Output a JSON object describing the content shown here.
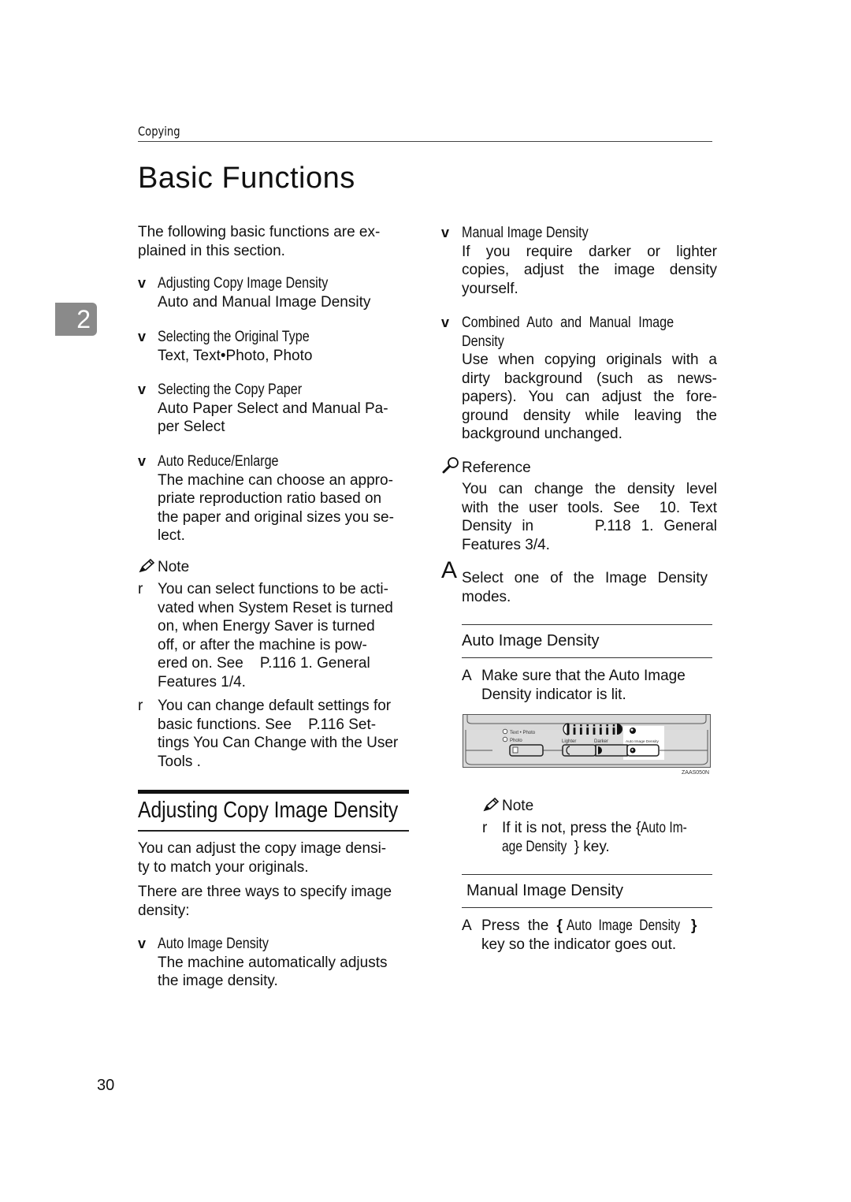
{
  "running_head": "Copying",
  "page_title": "Basic Functions",
  "chapter_tab": "2",
  "page_number": "30",
  "left_column": {
    "intro": "The following basic functions are explained in this section.",
    "intro_lines": [
      "The following basic functions are ex-",
      "plained in this section."
    ],
    "bullet_marker": "v",
    "functions": [
      {
        "title": "Adjusting Copy Image Density",
        "lines": [
          "Auto and Manual Image Density"
        ]
      },
      {
        "title": "Selecting the Original Type",
        "lines": [
          "Text, Text•Photo, Photo"
        ]
      },
      {
        "title": "Selecting the Copy Paper",
        "lines": [
          "Auto Paper Select and Manual Pa-",
          "per Select"
        ]
      },
      {
        "title": "Auto Reduce/Enlarge",
        "lines": [
          "The machine can choose an appro-",
          "priate reproduction ratio based on",
          "the paper and original sizes you se-",
          "lect."
        ]
      }
    ],
    "note": {
      "label": "Note",
      "marker": "r",
      "items": [
        {
          "lines": [
            "You can select functions to be acti-",
            "vated when System Reset is turned",
            "on, when Energy Saver is turned",
            "off, or after the machine is pow-",
            "ered on. See    P.116 1. General",
            "Features 1/4."
          ]
        },
        {
          "lines": [
            "You can change default settings for",
            "basic functions. See    P.116 Set-",
            "tings You Can Change with the User",
            "Tools ."
          ]
        }
      ]
    },
    "section": {
      "title": "Adjusting Copy Image Density",
      "para1_lines": [
        "You can adjust the copy image densi-",
        "ty to match your originals."
      ],
      "para2_lines": [
        "There are three ways to specify image",
        "density:"
      ],
      "auto": {
        "title": "Auto Image Density",
        "lines": [
          "The machine automatically adjusts",
          "the image density."
        ]
      }
    }
  },
  "right_column": {
    "manual": {
      "title": "Manual Image Density",
      "lines": [
        "If you require darker or lighter",
        "copies, adjust the image density",
        "yourself."
      ]
    },
    "combined": {
      "title_lines": [
        "Combined Auto and Manual Image",
        "Density"
      ],
      "lines": [
        "Use when copying originals with a",
        "dirty background (such as news-",
        "papers). You can adjust the fore-",
        "ground density while leaving the",
        "background unchanged."
      ]
    },
    "reference": {
      "label": "Reference",
      "lines": [
        "You can change the density level",
        "with the user tools. See  10. Text",
        "Density in      P.118 1. General",
        "Features 3/4."
      ]
    },
    "step_a": {
      "marker": "A",
      "lines": [
        "Select one of the Image Density",
        "modes."
      ]
    },
    "auto_sub": {
      "title": "Auto Image Density",
      "step": {
        "marker": "A",
        "lines": [
          "Make sure that the Auto Image",
          "Density indicator is lit."
        ]
      }
    },
    "panel": {
      "labels": {
        "text_photo": "Text • Photo",
        "photo": "Photo",
        "lighter": "Lighter",
        "darker": "Darker",
        "auto": "Auto Image Density"
      },
      "density_levels": 7,
      "figure_code": "ZAAS050N"
    },
    "note2": {
      "label": "Note",
      "marker": "r",
      "text_pre": "If it is not, press the ",
      "key_open": "{",
      "key": "Auto Im-",
      "key_line2": "age Density",
      "key_close": "}",
      "text_post": " key."
    },
    "manual_sub": {
      "title": "Manual Image Density",
      "step": {
        "marker": "A",
        "pre": "Press the ",
        "key_open": "{",
        "key": "Auto Image Density",
        "key_close": "}",
        "line2": "key so the indicator goes out."
      }
    }
  }
}
